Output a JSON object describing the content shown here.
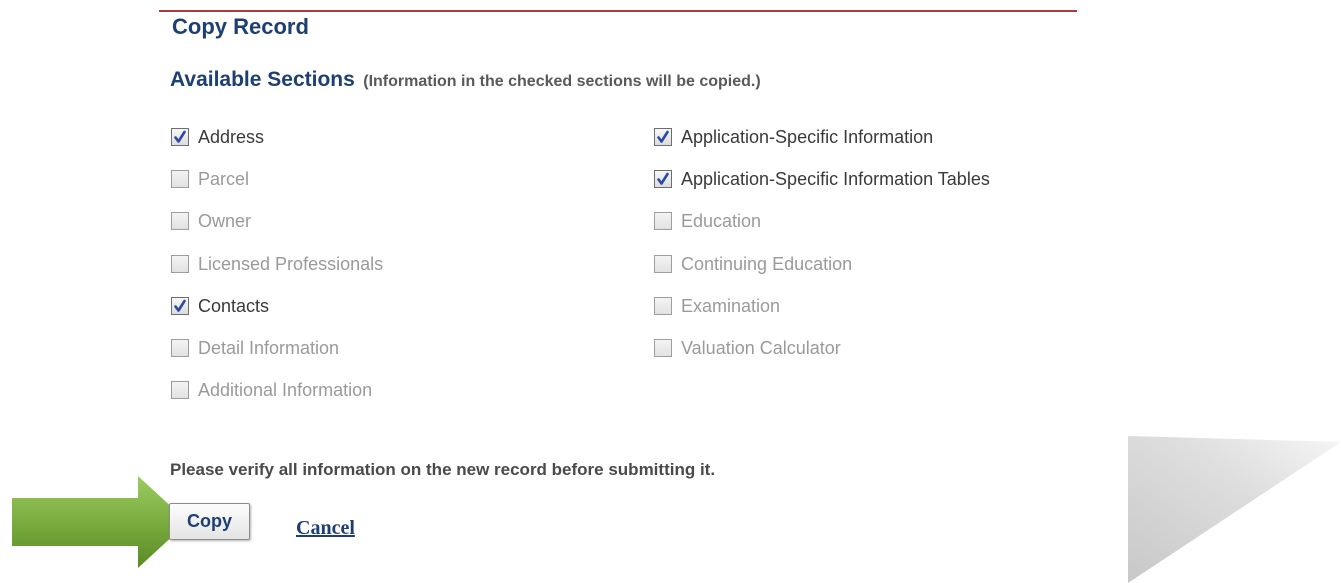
{
  "page": {
    "title": "Copy Record"
  },
  "sections": {
    "heading": "Available Sections",
    "note": "(Information in the checked sections will be copied.)",
    "left": [
      {
        "label": "Address",
        "checked": true
      },
      {
        "label": "Parcel",
        "checked": false
      },
      {
        "label": "Owner",
        "checked": false
      },
      {
        "label": "Licensed Professionals",
        "checked": false
      },
      {
        "label": "Contacts",
        "checked": true
      },
      {
        "label": "Detail Information",
        "checked": false
      },
      {
        "label": "Additional Information",
        "checked": false
      }
    ],
    "right": [
      {
        "label": "Application-Specific Information",
        "checked": true
      },
      {
        "label": "Application-Specific Information Tables",
        "checked": true
      },
      {
        "label": "Education",
        "checked": false
      },
      {
        "label": "Continuing Education",
        "checked": false
      },
      {
        "label": "Examination",
        "checked": false
      },
      {
        "label": "Valuation Calculator",
        "checked": false
      }
    ]
  },
  "footer": {
    "verify_note": "Please verify all information on the new record before submitting it.",
    "copy_label": "Copy",
    "cancel_label": "Cancel"
  },
  "colors": {
    "heading": "#1e3f73",
    "rule": "#b03a3a",
    "arrow": "#77a93c",
    "checkmark": "#2b4aa8"
  },
  "icons": {
    "callout": "green-arrow-icon",
    "checkbox_tick": "checkmark-icon"
  }
}
